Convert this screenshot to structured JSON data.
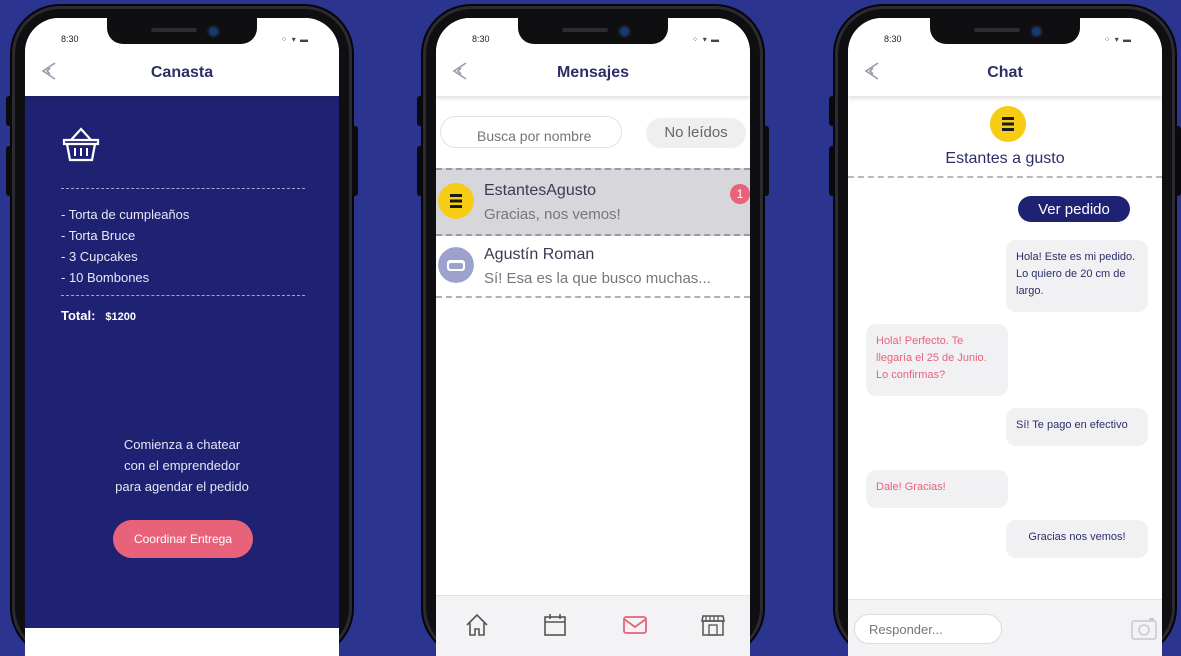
{
  "phone_status": {
    "time": "8:30",
    "icons": "⁘ ▾ ▬"
  },
  "cart": {
    "title": "Canasta",
    "items": [
      "- Torta de cumpleaños",
      "- Torta Bruce",
      "- 3 Cupcakes",
      "- 10 Bombones"
    ],
    "total_label": "Total:",
    "total_value": "$1200",
    "cta_lines": [
      "Comienza a chatear",
      "con el emprendedor",
      "para agendar el pedido"
    ],
    "button_label": "Coordinar Entrega"
  },
  "messages": {
    "title": "Mensajes",
    "search_placeholder": "Busca por nombre",
    "filter_label": "No leídos",
    "conversations": [
      {
        "name": "EstantesAgusto",
        "preview": "Gracias, nos vemos!",
        "unread": "1"
      },
      {
        "name": "Agustín Roman",
        "preview": "Sí! Esa es la que busco muchas..."
      }
    ]
  },
  "chat": {
    "title": "Chat",
    "store_name": "Estantes a gusto",
    "order_button": "Ver pedido",
    "messages": [
      {
        "from": "me",
        "text": "Hola! Este es mi pedido. Lo quiero de 20 cm de largo."
      },
      {
        "from": "them",
        "text": "Hola! Perfecto. Te llegaría el 25 de Junio. Lo confirmas?"
      },
      {
        "from": "me",
        "text": "Sí! Te pago en efectivo"
      },
      {
        "from": "them",
        "text": "Dale! Gracias!"
      },
      {
        "from": "me",
        "text": "Gracias nos vemos!"
      }
    ],
    "reply_placeholder": "Responder..."
  },
  "colors": {
    "brand_dark": "#1f2272",
    "accent_pink": "#e8637a",
    "logo_yellow": "#f6cc14",
    "background": "#2b3590"
  }
}
